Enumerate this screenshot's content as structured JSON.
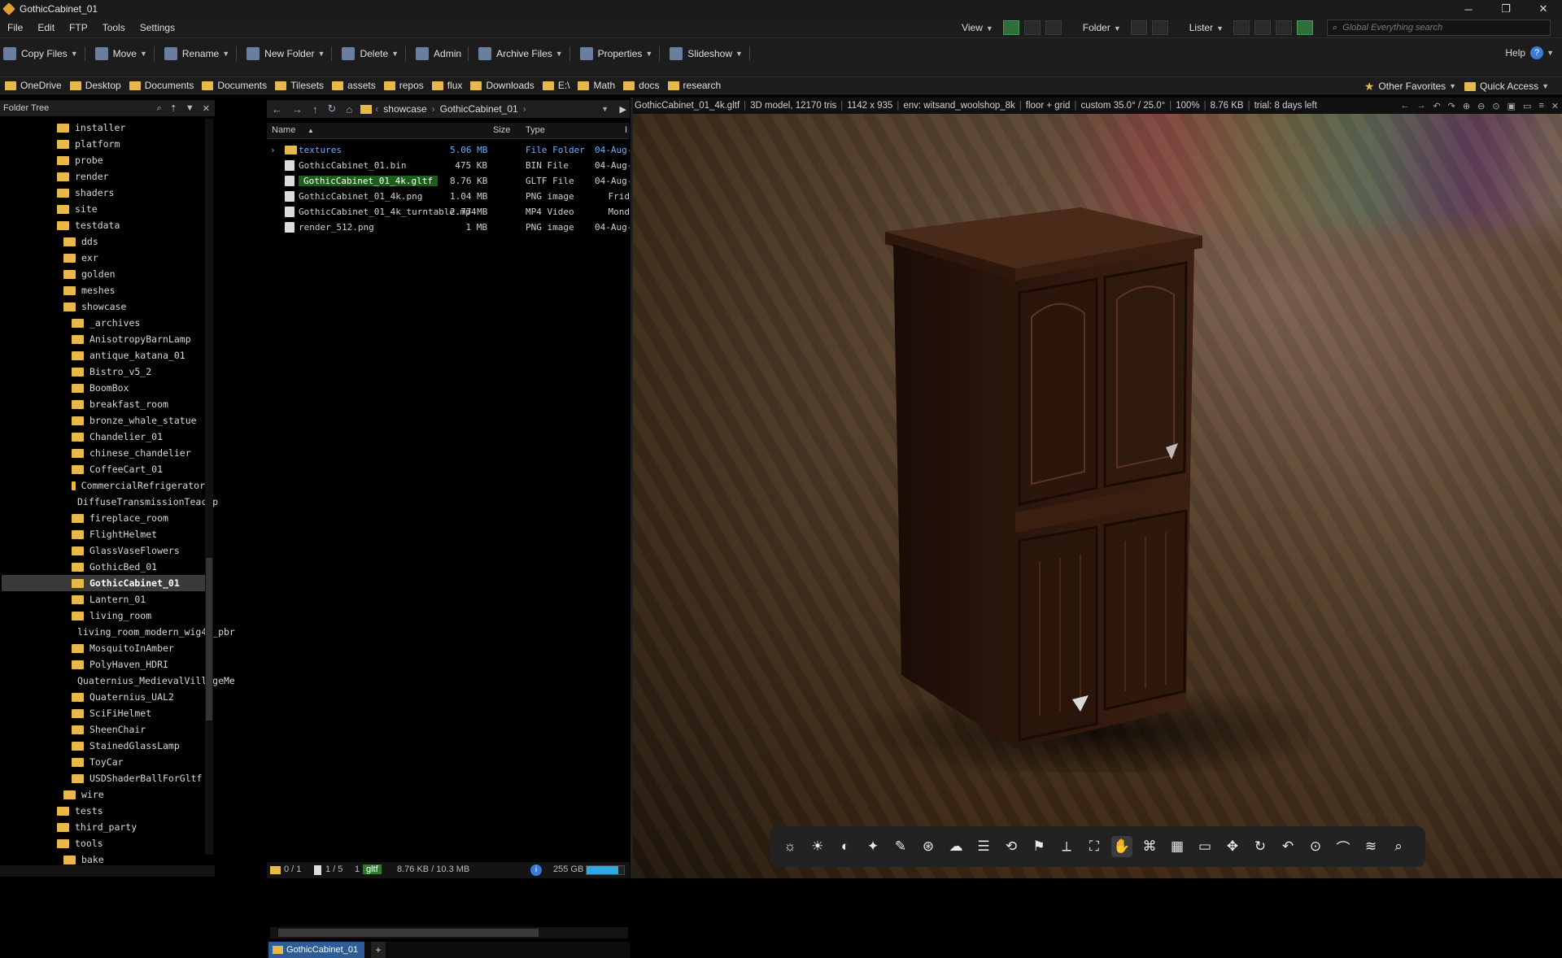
{
  "window": {
    "title": "GothicCabinet_01",
    "min": "─",
    "max": "❐",
    "close": "✕"
  },
  "menu": [
    "File",
    "Edit",
    "FTP",
    "Tools",
    "Settings"
  ],
  "menu_right": {
    "view": "View",
    "folder": "Folder",
    "lister": "Lister",
    "search_placeholder": "Global Everything search"
  },
  "toolbar": [
    {
      "label": "Copy Files",
      "icon": "copy-files-icon",
      "dd": true
    },
    {
      "label": "Move",
      "icon": "move-icon",
      "dd": true
    },
    {
      "label": "Rename",
      "icon": "rename-icon",
      "dd": true
    },
    {
      "label": "New Folder",
      "icon": "new-folder-icon",
      "dd": true
    },
    {
      "label": "Delete",
      "icon": "delete-icon",
      "dd": true
    },
    {
      "label": "Admin",
      "icon": "admin-icon",
      "dd": false
    },
    {
      "label": "Archive Files",
      "icon": "archive-icon",
      "dd": true
    },
    {
      "label": "Properties",
      "icon": "properties-icon",
      "dd": true
    },
    {
      "label": "Slideshow",
      "icon": "slideshow-icon",
      "dd": true
    }
  ],
  "help": {
    "label": "Help",
    "glyph": "?"
  },
  "favorites": [
    "OneDrive",
    "Desktop",
    "Documents",
    "Documents",
    "Tilesets",
    "assets",
    "repos",
    "flux",
    "Downloads",
    "E:\\",
    "Math",
    "docs",
    "research"
  ],
  "favorites_right": {
    "other": "Other Favorites",
    "quick": "Quick Access"
  },
  "tree": {
    "header": "Folder Tree",
    "items": [
      {
        "name": "installer",
        "depth": 1
      },
      {
        "name": "platform",
        "depth": 1
      },
      {
        "name": "probe",
        "depth": 1
      },
      {
        "name": "render",
        "depth": 1
      },
      {
        "name": "shaders",
        "depth": 1
      },
      {
        "name": "site",
        "depth": 1
      },
      {
        "name": "testdata",
        "depth": 1
      },
      {
        "name": "dds",
        "depth": 2
      },
      {
        "name": "exr",
        "depth": 2
      },
      {
        "name": "golden",
        "depth": 2
      },
      {
        "name": "meshes",
        "depth": 2
      },
      {
        "name": "showcase",
        "depth": 2
      },
      {
        "name": "_archives",
        "depth": 3
      },
      {
        "name": "AnisotropyBarnLamp",
        "depth": 3
      },
      {
        "name": "antique_katana_01",
        "depth": 3
      },
      {
        "name": "Bistro_v5_2",
        "depth": 3
      },
      {
        "name": "BoomBox",
        "depth": 3
      },
      {
        "name": "breakfast_room",
        "depth": 3
      },
      {
        "name": "bronze_whale_statue",
        "depth": 3
      },
      {
        "name": "Chandelier_01",
        "depth": 3
      },
      {
        "name": "chinese_chandelier",
        "depth": 3
      },
      {
        "name": "CoffeeCart_01",
        "depth": 3
      },
      {
        "name": "CommercialRefrigerator",
        "depth": 3
      },
      {
        "name": "DiffuseTransmissionTeacup",
        "depth": 3
      },
      {
        "name": "fireplace_room",
        "depth": 3
      },
      {
        "name": "FlightHelmet",
        "depth": 3
      },
      {
        "name": "GlassVaseFlowers",
        "depth": 3
      },
      {
        "name": "GothicBed_01",
        "depth": 3
      },
      {
        "name": "GothicCabinet_01",
        "depth": 3,
        "selected": true
      },
      {
        "name": "Lantern_01",
        "depth": 3
      },
      {
        "name": "living_room",
        "depth": 3
      },
      {
        "name": "living_room_modern_wig42_pbr",
        "depth": 3
      },
      {
        "name": "MosquitoInAmber",
        "depth": 3
      },
      {
        "name": "PolyHaven_HDRI",
        "depth": 3
      },
      {
        "name": "Quaternius_MedievalVillageMe",
        "depth": 3
      },
      {
        "name": "Quaternius_UAL2",
        "depth": 3
      },
      {
        "name": "SciFiHelmet",
        "depth": 3
      },
      {
        "name": "SheenChair",
        "depth": 3
      },
      {
        "name": "StainedGlassLamp",
        "depth": 3
      },
      {
        "name": "ToyCar",
        "depth": 3
      },
      {
        "name": "USDShaderBallForGltf",
        "depth": 3
      },
      {
        "name": "wire",
        "depth": 2
      },
      {
        "name": "tests",
        "depth": 1
      },
      {
        "name": "third_party",
        "depth": 1
      },
      {
        "name": "tools",
        "depth": 1
      },
      {
        "name": "bake",
        "depth": 2
      }
    ]
  },
  "path": {
    "crumbs": [
      "showcase",
      "GothicCabinet_01"
    ]
  },
  "files": {
    "columns": {
      "name": "Name",
      "size": "Size",
      "type": "Type",
      "date": "I"
    },
    "rows": [
      {
        "name": "textures",
        "size": "5.06 MB",
        "type": "File Folder",
        "date": "04-Aug-",
        "dir": true
      },
      {
        "name": "GothicCabinet_01.bin",
        "size": "475 KB",
        "type": "BIN File",
        "date": "04-Aug-"
      },
      {
        "name": "GothicCabinet_01_4k.gltf",
        "size": "8.76 KB",
        "type": "GLTF File",
        "date": "04-Aug-",
        "selected": true
      },
      {
        "name": "GothicCabinet_01_4k.png",
        "size": "1.04 MB",
        "type": "PNG image",
        "date": "Frid"
      },
      {
        "name": "GothicCabinet_01_4k_turntable.mp4",
        "size": "2.77 MB",
        "type": "MP4 Video",
        "date": "Mond"
      },
      {
        "name": "render_512.png",
        "size": "1 MB",
        "type": "PNG image",
        "date": "04-Aug-"
      }
    ]
  },
  "tab": {
    "label": "GothicCabinet_01",
    "plus": "+"
  },
  "status": {
    "folders": "0 / 1",
    "files": "1 / 5",
    "sel_count": "1",
    "ext": "gltf",
    "sizes": "8.76 KB / 10.3 MB",
    "free": "255 GB",
    "free_fill": 0.85
  },
  "viewer_info": [
    "GothicCabinet_01_4k.gltf",
    "3D model, 12170 tris",
    "1142 x 935",
    "env: witsand_woolshop_8k",
    "floor + grid",
    "custom 35.0° / 25.0°",
    "100%",
    "8.76 KB",
    "trial: 8 days left"
  ],
  "viewer_tools": [
    {
      "icon": "exposure-icon",
      "g": "☼"
    },
    {
      "icon": "light-icon",
      "g": "☀"
    },
    {
      "icon": "contrast-icon",
      "g": "◐"
    },
    {
      "icon": "sparkle-icon",
      "g": "✦"
    },
    {
      "icon": "brush-icon",
      "g": "✎"
    },
    {
      "icon": "aperture-icon",
      "g": "⊛"
    },
    {
      "icon": "cloud-icon",
      "g": "☁"
    },
    {
      "icon": "list-icon",
      "g": "☰"
    },
    {
      "icon": "cube-rotate-icon",
      "g": "⟲"
    },
    {
      "icon": "bookmark-icon",
      "g": "⚑"
    },
    {
      "icon": "axis-icon",
      "g": "⟂"
    },
    {
      "icon": "frame-icon",
      "g": "⛶"
    },
    {
      "icon": "pan-hand-icon",
      "g": "✋",
      "active": true
    },
    {
      "icon": "network-icon",
      "g": "⌘"
    },
    {
      "icon": "grid-icon",
      "g": "▦"
    },
    {
      "icon": "ruler-icon",
      "g": "▭"
    },
    {
      "icon": "move-gizmo-icon",
      "g": "✥"
    },
    {
      "icon": "refresh-icon",
      "g": "↻"
    },
    {
      "icon": "undo-icon",
      "g": "↶"
    },
    {
      "icon": "camera-icon",
      "g": "⊙"
    },
    {
      "icon": "lasso-icon",
      "g": "⌒"
    },
    {
      "icon": "layers-icon",
      "g": "≋"
    },
    {
      "icon": "zoom-search-icon",
      "g": "⌕"
    }
  ],
  "colors": {
    "selection_green": "#1f5d1f",
    "accent_blue": "#2e5c95",
    "folder_yellow": "#e7b84a"
  }
}
